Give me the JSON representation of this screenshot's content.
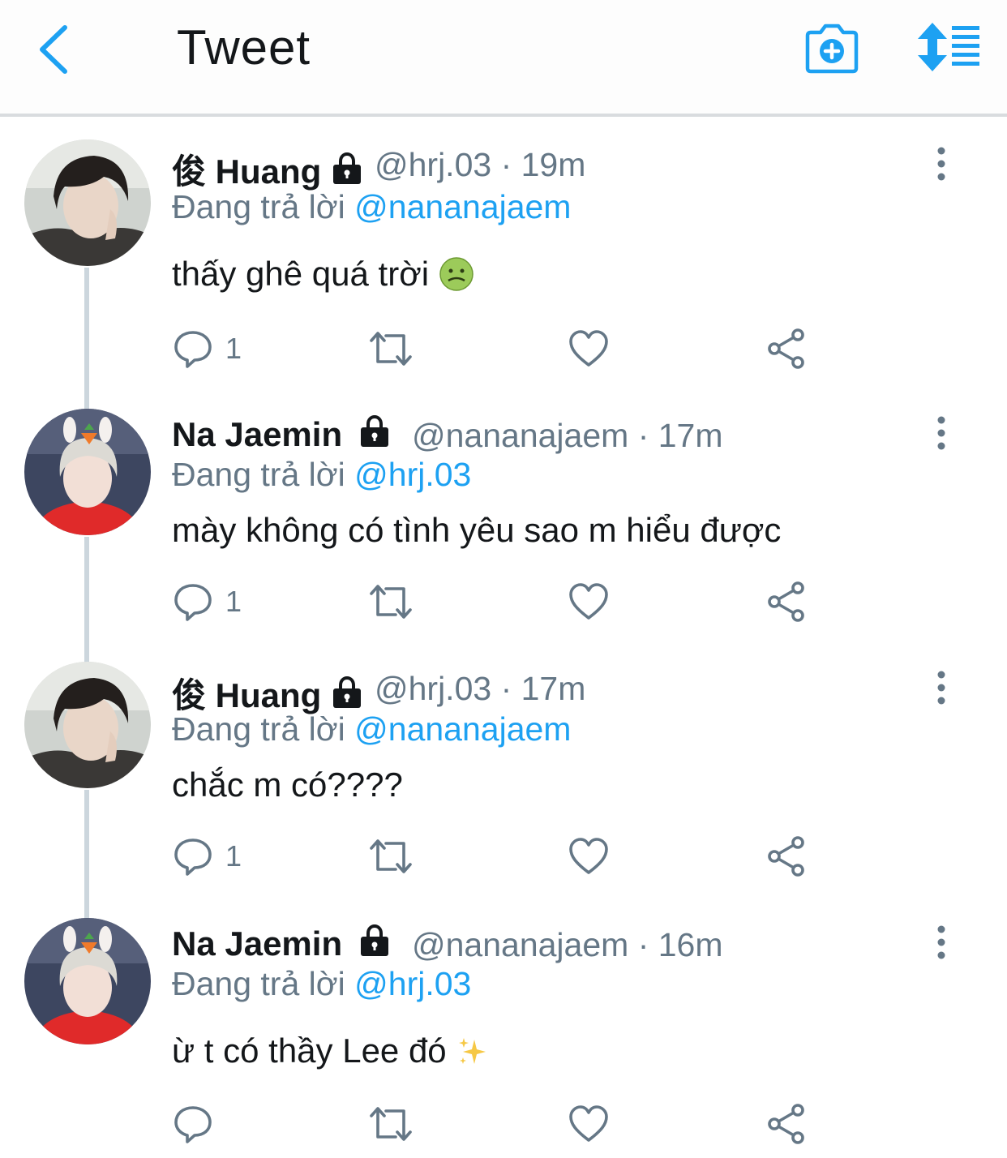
{
  "header": {
    "title": "Tweet"
  },
  "tweets": [
    {
      "name": "俊 Huang",
      "handle": "@hrj.03",
      "time": "19m",
      "reply_prefix": "Đang trả lời",
      "reply_to": "@nananajaem",
      "text": "thấy ghê quá trời",
      "replies": "1",
      "emoji": "nauseated-face"
    },
    {
      "name": "Na Jaemin",
      "handle": "@nananajaem",
      "time": "17m",
      "reply_prefix": "Đang trả lời",
      "reply_to": "@hrj.03",
      "text": "mày không có tình yêu sao m hiểu được",
      "replies": "1"
    },
    {
      "name": "俊 Huang",
      "handle": "@hrj.03",
      "time": "17m",
      "reply_prefix": "Đang trả lời",
      "reply_to": "@nananajaem",
      "text": "chắc m có????",
      "replies": "1"
    },
    {
      "name": "Na Jaemin",
      "handle": "@nananajaem",
      "time": "16m",
      "reply_prefix": "Đang trả lời",
      "reply_to": "@hrj.03",
      "text": "ừ t có thầy Lee đó",
      "replies": "",
      "emoji": "sparkles"
    }
  ],
  "colors": {
    "accent": "#1da1f2",
    "icon": "#657786",
    "text": "#14171a"
  }
}
